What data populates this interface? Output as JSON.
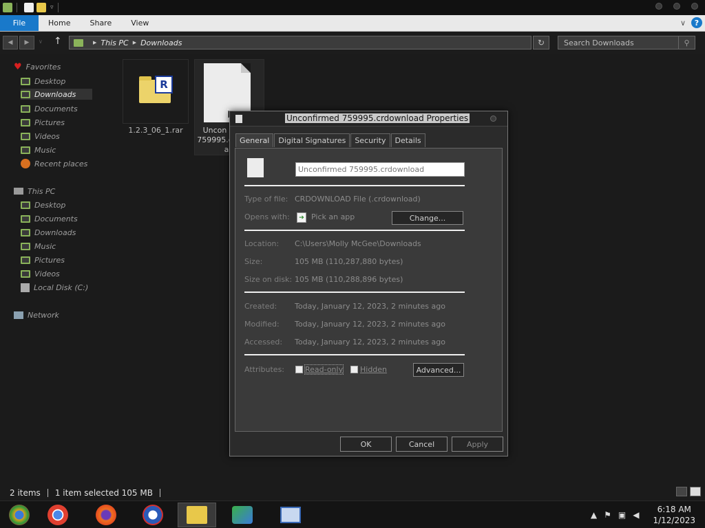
{
  "window": {
    "title_controls": [
      "minimize",
      "maximize",
      "close"
    ]
  },
  "ribbon": {
    "tabs": [
      "File",
      "Home",
      "Share",
      "View"
    ],
    "accent": "#1979ca"
  },
  "address": {
    "crumbs": [
      "This PC",
      "Downloads"
    ]
  },
  "search": {
    "placeholder": "Search Downloads"
  },
  "sidebar": {
    "favorites_label": "Favorites",
    "favorites": [
      "Desktop",
      "Downloads",
      "Documents",
      "Pictures",
      "Videos",
      "Music",
      "Recent places"
    ],
    "thispc_label": "This PC",
    "thispc": [
      "Desktop",
      "Documents",
      "Downloads",
      "Music",
      "Pictures",
      "Videos",
      "Local Disk (C:)"
    ],
    "network_label": "Network",
    "selected": "Downloads"
  },
  "files": [
    {
      "name": "1.2.3_06_1.rar",
      "icon": "rar-archive-icon"
    },
    {
      "name_lines": [
        "Uncon",
        "759995.c",
        "a"
      ],
      "icon": "document-icon"
    }
  ],
  "status": {
    "items": "2 items",
    "selected": "1 item selected  105 MB"
  },
  "taskbar": {
    "apps": [
      "app-icon",
      "chrome-icon",
      "firefox-icon",
      "obama-icon",
      "file-explorer-icon",
      "network-users-icon",
      "remote-desktop-icon"
    ],
    "time": "6:18 AM",
    "date": "1/12/2023"
  },
  "dialog": {
    "title": "Unconfirmed 759995.crdownload Properties",
    "tabs": [
      "General",
      "Digital Signatures",
      "Security",
      "Details"
    ],
    "active_tab": "General",
    "filename": "Unconfirmed 759995.crdownload",
    "type_label": "Type of file:",
    "type_value": "CRDOWNLOAD File (.crdownload)",
    "opens_label": "Opens with:",
    "opens_value": "Pick an app",
    "change_button": "Change...",
    "location_label": "Location:",
    "location_value": "C:\\Users\\Molly McGee\\Downloads",
    "size_label": "Size:",
    "size_value": "105 MB (110,287,880 bytes)",
    "sizeondisk_label": "Size on disk:",
    "sizeondisk_value": "105 MB (110,288,896 bytes)",
    "created_label": "Created:",
    "created_value": "Today, January 12, 2023, 2 minutes ago",
    "modified_label": "Modified:",
    "modified_value": "Today, January 12, 2023, 2 minutes ago",
    "accessed_label": "Accessed:",
    "accessed_value": "Today, January 12, 2023, 2 minutes ago",
    "attributes_label": "Attributes:",
    "readonly_label": "Read-only",
    "readonly_checked": false,
    "hidden_label": "Hidden",
    "hidden_checked": false,
    "advanced_button": "Advanced...",
    "ok_button": "OK",
    "cancel_button": "Cancel",
    "apply_button": "Apply"
  }
}
